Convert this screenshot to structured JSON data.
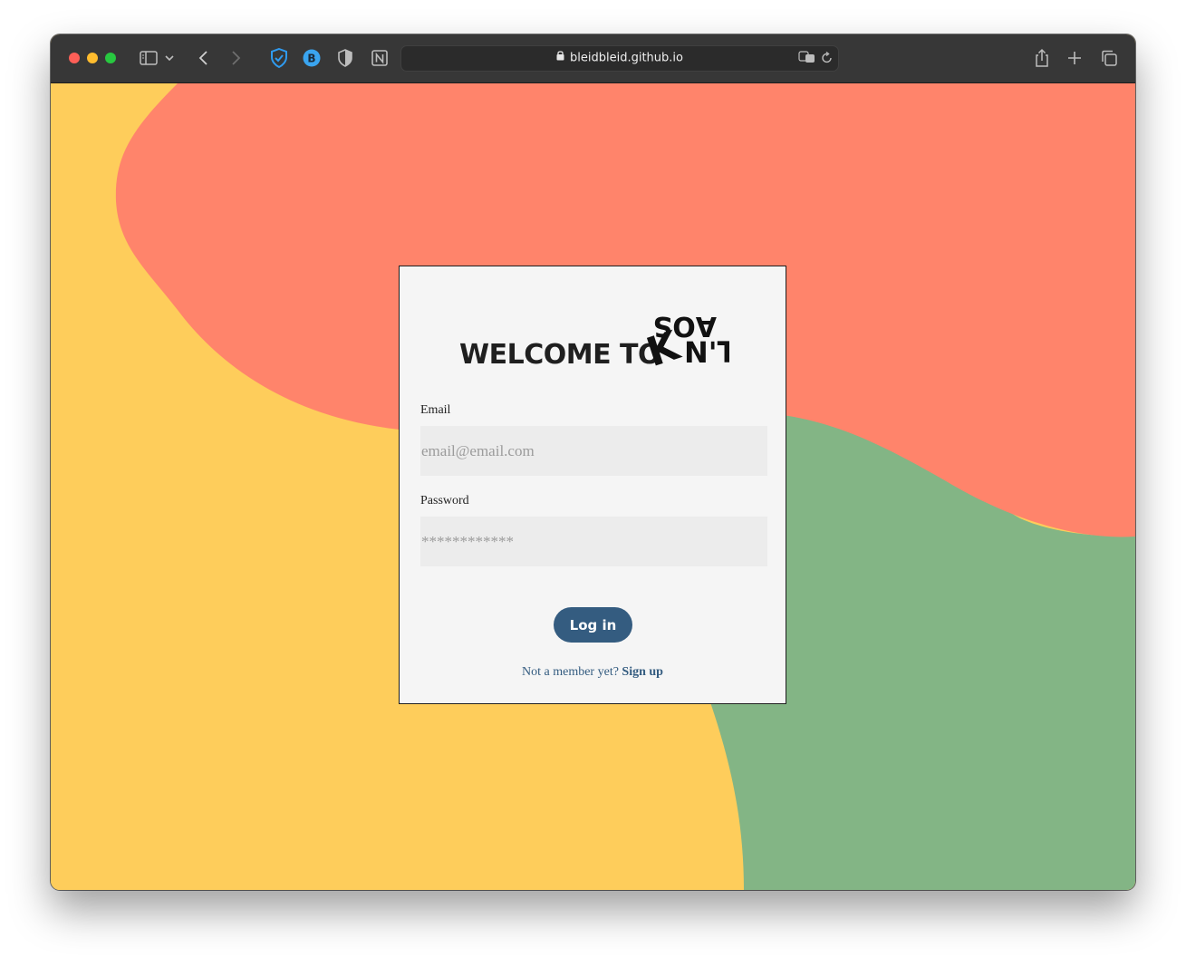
{
  "browser": {
    "url": "bleidbleid.github.io",
    "icons": {
      "sidebar": "sidebar-icon",
      "back": "chevron-left-icon",
      "forward": "chevron-right-icon",
      "ext1": "shield-check-icon",
      "ext2": "b-circle-icon",
      "ext3": "half-shield-icon",
      "ext4": "notion-icon",
      "translate": "translate-icon",
      "reload": "reload-icon",
      "share": "share-icon",
      "new_tab": "plus-icon",
      "tabs": "tabs-overview-icon"
    },
    "ext_b_label": "B"
  },
  "page": {
    "colors": {
      "yellow": "#fecd5b",
      "coral": "#ff846b",
      "green": "#83b585",
      "button": "#345c80"
    },
    "heading": "WELCOME TO",
    "logo_text": "KAOS N'T",
    "email_label": "Email",
    "email_placeholder": "email@email.com",
    "password_label": "Password",
    "password_placeholder": "************",
    "login_button": "Log in",
    "signup_prompt": "Not a member yet?",
    "signup_link": "Sign up"
  }
}
